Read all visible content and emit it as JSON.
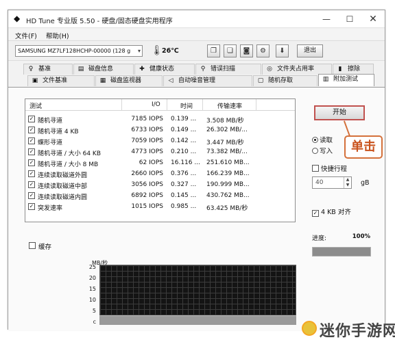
{
  "window": {
    "title": "HD Tune 专业版 5.50 - 硬盘/固态硬盘实用程序",
    "controls": {
      "minimize": "—",
      "maximize": "☐",
      "close": "✕"
    }
  },
  "menu": {
    "file": "文件(F)",
    "help": "帮助(H)"
  },
  "toolbar": {
    "drive": "SAMSUNG MZ7LF128HCHP-00000 (128 g",
    "temperature": "26℃",
    "exit_label": "退出",
    "icons": [
      "copy-icon",
      "copy-all-icon",
      "camera-icon",
      "settings-icon",
      "save-icon"
    ]
  },
  "tabs": {
    "row1": [
      {
        "label": "基准",
        "icon": "benchmark-icon"
      },
      {
        "label": "磁盘信息",
        "icon": "disk-info-icon"
      },
      {
        "label": "健康状态",
        "icon": "health-icon"
      },
      {
        "label": "错误扫描",
        "icon": "error-scan-icon"
      },
      {
        "label": "文件夹占用率",
        "icon": "folder-usage-icon"
      },
      {
        "label": "擦除",
        "icon": "erase-icon"
      }
    ],
    "row2": [
      {
        "label": "文件基准",
        "icon": "file-benchmark-icon"
      },
      {
        "label": "磁盘监视器",
        "icon": "disk-monitor-icon"
      },
      {
        "label": "自动噪音管理",
        "icon": "noise-icon"
      },
      {
        "label": "随机存取",
        "icon": "random-access-icon"
      },
      {
        "label": "附加测试",
        "icon": "extra-tests-icon"
      }
    ]
  },
  "results": {
    "headers": {
      "test": "测试",
      "io": "I/O",
      "time": "时间",
      "speed": "传输速率"
    },
    "rows": [
      {
        "name": "随机寻道",
        "io": "7185 IOPS",
        "time": "0.139 ...",
        "speed": "3.508 MB/秒",
        "checked": "✓"
      },
      {
        "name": "随机寻道 4 KB",
        "io": "6733 IOPS",
        "time": "0.149 ...",
        "speed": "26.302 MB/...",
        "checked": "✓"
      },
      {
        "name": "蝶形寻道",
        "io": "7059 IOPS",
        "time": "0.142 ...",
        "speed": "3.447 MB/秒",
        "checked": "✓"
      },
      {
        "name": "随机寻道 / 大小 64 KB",
        "io": "4773 IOPS",
        "time": "0.210 ...",
        "speed": "73.382 MB/...",
        "checked": "✓"
      },
      {
        "name": "随机寻道 / 大小 8 MB",
        "io": "62 IOPS",
        "time": "16.116 ...",
        "speed": "251.610 MB...",
        "checked": "✓"
      },
      {
        "name": "连续读取磁道外圆",
        "io": "2660 IOPS",
        "time": "0.376 ...",
        "speed": "166.239 MB...",
        "checked": "✓"
      },
      {
        "name": "连续读取磁道中部",
        "io": "3056 IOPS",
        "time": "0.327 ...",
        "speed": "190.999 MB...",
        "checked": "✓"
      },
      {
        "name": "连续读取磁道内圆",
        "io": "6892 IOPS",
        "time": "0.145 ...",
        "speed": "430.762 MB...",
        "checked": "✓"
      },
      {
        "name": "突发速率",
        "io": "1015 IOPS",
        "time": "0.985 ...",
        "speed": "63.425 MB/秒",
        "checked": "✓"
      }
    ]
  },
  "options": {
    "start_label": "开始",
    "read_label": "读取",
    "write_label": "写入",
    "quick_stroke_label": "快捷行程",
    "quick_stroke_value": "40",
    "quick_stroke_unit": "gB",
    "align_label": "4 KB 对齐",
    "align_check": "✓",
    "progress_label": "进度:",
    "progress_percent": "100%",
    "progress_fraction": 1.0,
    "callout_label": "单击"
  },
  "graph": {
    "cache_label": "缓存",
    "unit": "MB/秒",
    "yticks": [
      "25",
      "20",
      "15",
      "10",
      "5",
      "c"
    ]
  },
  "watermark": {
    "text": "迷你手游网"
  },
  "colors": {
    "accent_red": "#c0504d",
    "callout_orange": "#d4703a"
  }
}
